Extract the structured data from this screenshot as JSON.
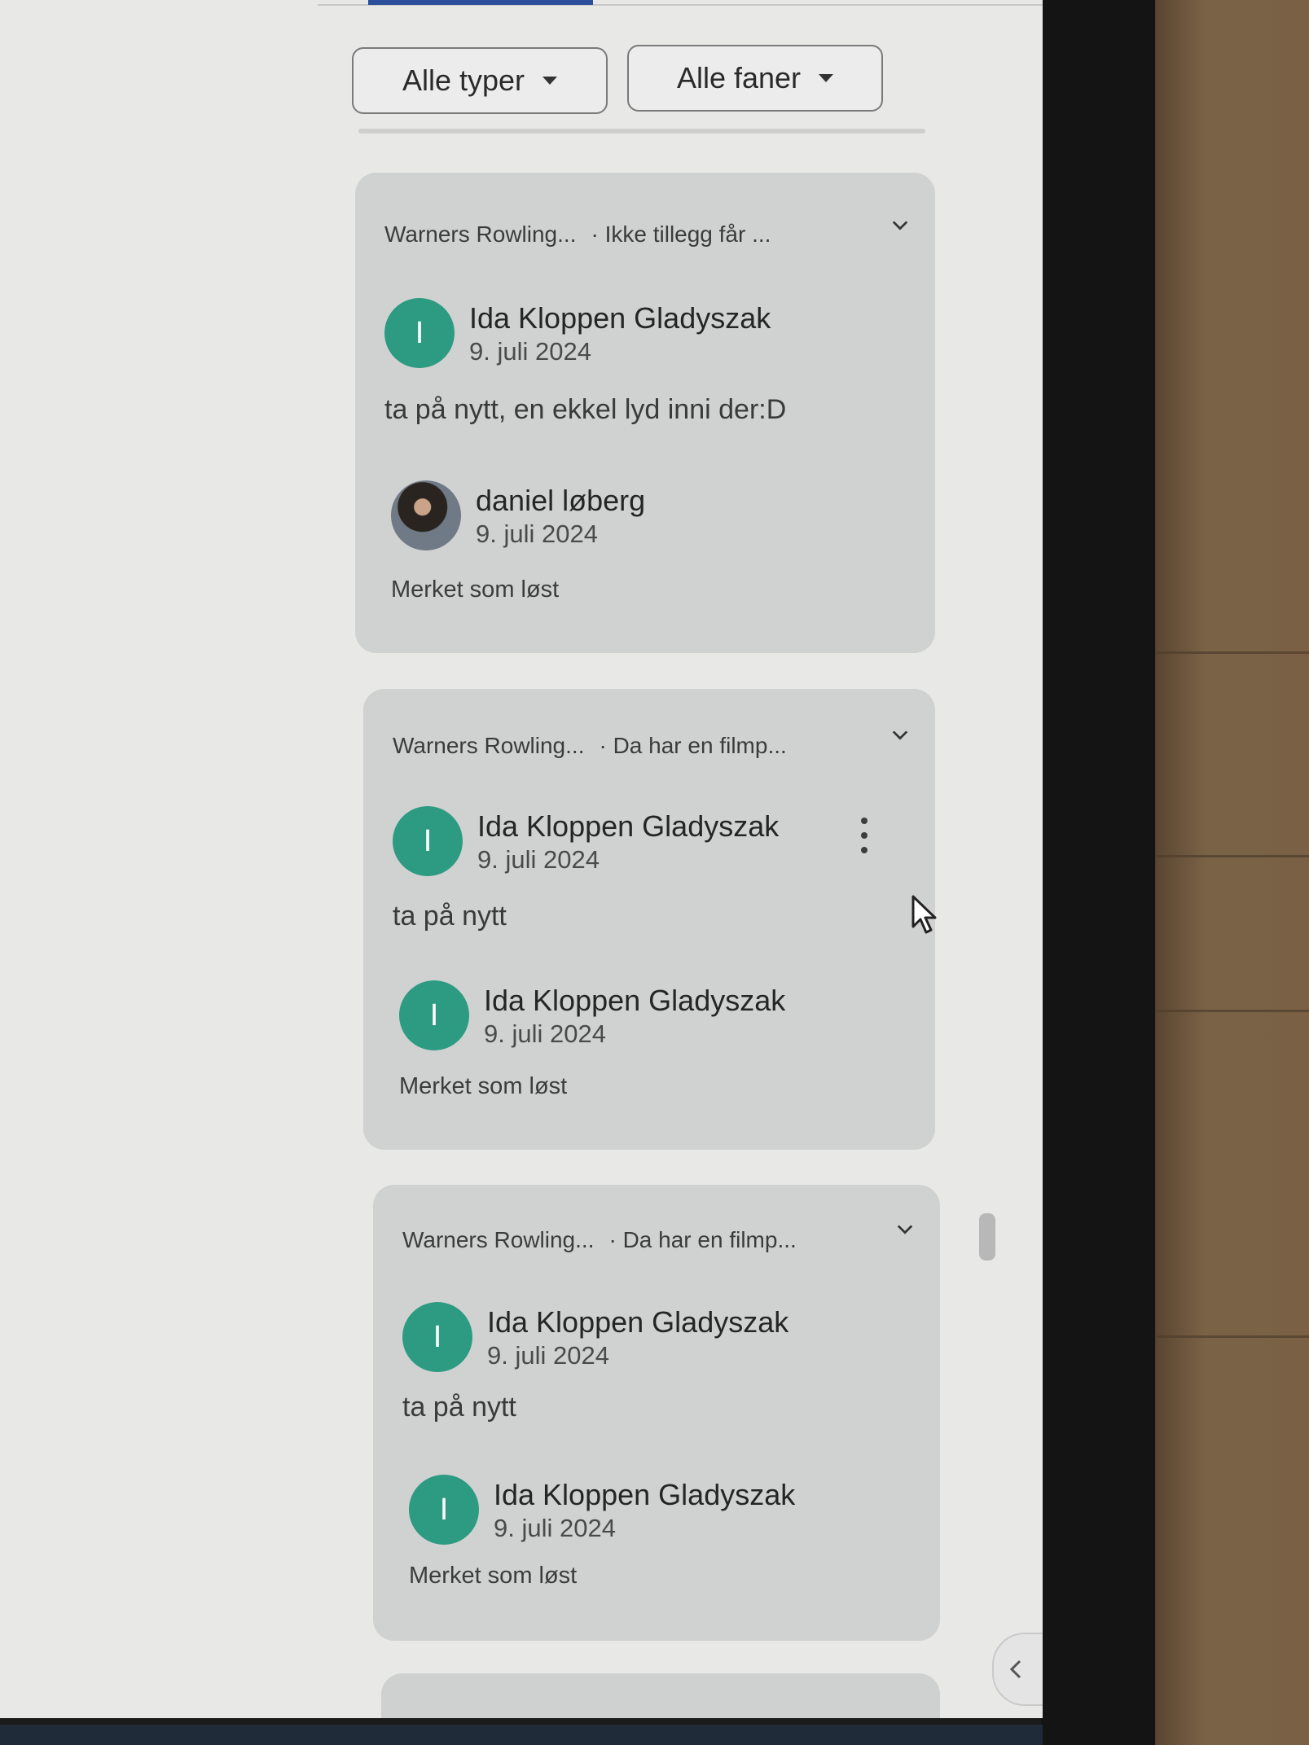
{
  "filters": {
    "type_label": "Alle typer",
    "tab_label": "Alle faner"
  },
  "cards": [
    {
      "source": "Warners Rowling...",
      "snippet": "· Ikke tillegg får ...",
      "author": {
        "initial": "I",
        "name": "Ida Kloppen Gladyszak",
        "date": "9. juli 2024"
      },
      "comment": "ta på nytt, en ekkel lyd inni der:D",
      "resolver": {
        "name": "daniel løberg",
        "date": "9. juli 2024"
      },
      "resolved_text": "Merket som løst"
    },
    {
      "source": "Warners Rowling...",
      "snippet": "· Da har en filmp...",
      "author": {
        "initial": "I",
        "name": "Ida Kloppen Gladyszak",
        "date": "9. juli 2024"
      },
      "comment": "ta på nytt",
      "resolver": {
        "initial": "I",
        "name": "Ida Kloppen Gladyszak",
        "date": "9. juli 2024"
      },
      "resolved_text": "Merket som løst"
    },
    {
      "source": "Warners Rowling...",
      "snippet": "· Da har en filmp...",
      "author": {
        "initial": "I",
        "name": "Ida Kloppen Gladyszak",
        "date": "9. juli 2024"
      },
      "comment": "ta på nytt",
      "resolver": {
        "initial": "I",
        "name": "Ida Kloppen Gladyszak",
        "date": "9. juli 2024"
      },
      "resolved_text": "Merket som løst"
    }
  ],
  "colors": {
    "avatar": "#2d9b82",
    "card": "#d0d2d1",
    "accent": "#2b4f9a"
  },
  "icons": [
    "chevron-down-icon",
    "caret-down-icon",
    "more-vert-icon",
    "chevron-left-icon",
    "cursor-arrow-icon"
  ]
}
